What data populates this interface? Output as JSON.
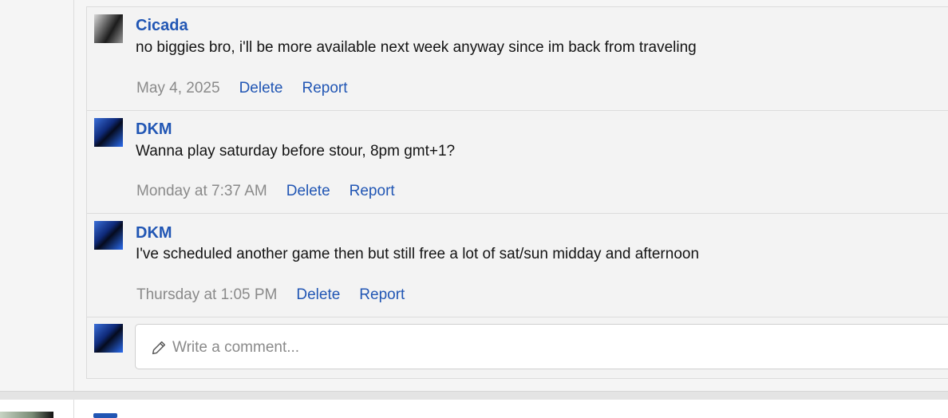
{
  "comments": [
    {
      "author": "Cicada",
      "avatar": "cicada-avatar",
      "text": "no biggies bro, i'll be more available next week anyway since im back from traveling",
      "time": "May 4, 2025",
      "delete_label": "Delete",
      "report_label": "Report"
    },
    {
      "author": "DKM",
      "avatar": "dkm-avatar",
      "text": "Wanna play saturday before stour, 8pm gmt+1?",
      "time": "Monday at 7:37 AM",
      "delete_label": "Delete",
      "report_label": "Report"
    },
    {
      "author": "DKM",
      "avatar": "dkm-avatar",
      "text": "I've scheduled another game then but still free a lot of sat/sun midday and afternoon",
      "time": "Thursday at 1:05 PM",
      "delete_label": "Delete",
      "report_label": "Report"
    }
  ],
  "composer": {
    "placeholder": "Write a comment...",
    "icon": "pencil-icon"
  },
  "colors": {
    "link": "#2156b4",
    "muted": "#8a8a8a",
    "text": "#141414",
    "background": "#f3f3f3"
  }
}
